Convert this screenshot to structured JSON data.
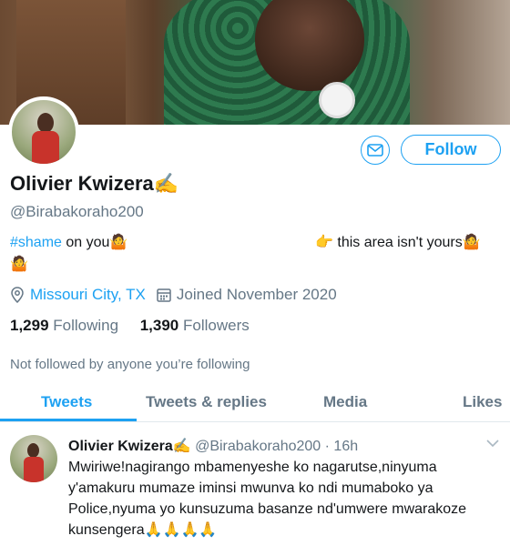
{
  "header": {
    "follow_label": "Follow",
    "message_icon": "envelope-icon"
  },
  "profile": {
    "name": "Olivier Kwizera✍️",
    "handle": "@Birabakoraho200",
    "bio_hashtag": "#shame",
    "bio_part1": " on you🤷",
    "bio_part2": "👉 this area isn't yours🤷",
    "bio_part3": "🤷",
    "location": "Missouri City, TX",
    "joined": "Joined November 2020",
    "following_count": "1,299",
    "following_label": "Following",
    "followers_count": "1,390",
    "followers_label": "Followers",
    "not_followed_text": "Not followed by anyone you’re following"
  },
  "tabs": [
    {
      "label": "Tweets",
      "active": true
    },
    {
      "label": "Tweets & replies",
      "active": false
    },
    {
      "label": "Media",
      "active": false
    },
    {
      "label": "Likes",
      "active": false
    }
  ],
  "tweet": {
    "author": "Olivier Kwizera✍️",
    "meta": " @Birabakoraho200 · 16h",
    "text": "Mwiriwe!nagirango mbamenyeshe ko nagarutse,ninyuma y'amakuru mumaze iminsi mwunva ko ndi mumaboko ya Police,nyuma yo kunsuzuma basanze nd'umwere mwarakoze kunsengera🙏🙏🙏🙏"
  },
  "colors": {
    "accent": "#1da1f2",
    "secondary_text": "#657786",
    "primary_text": "#14171a"
  }
}
